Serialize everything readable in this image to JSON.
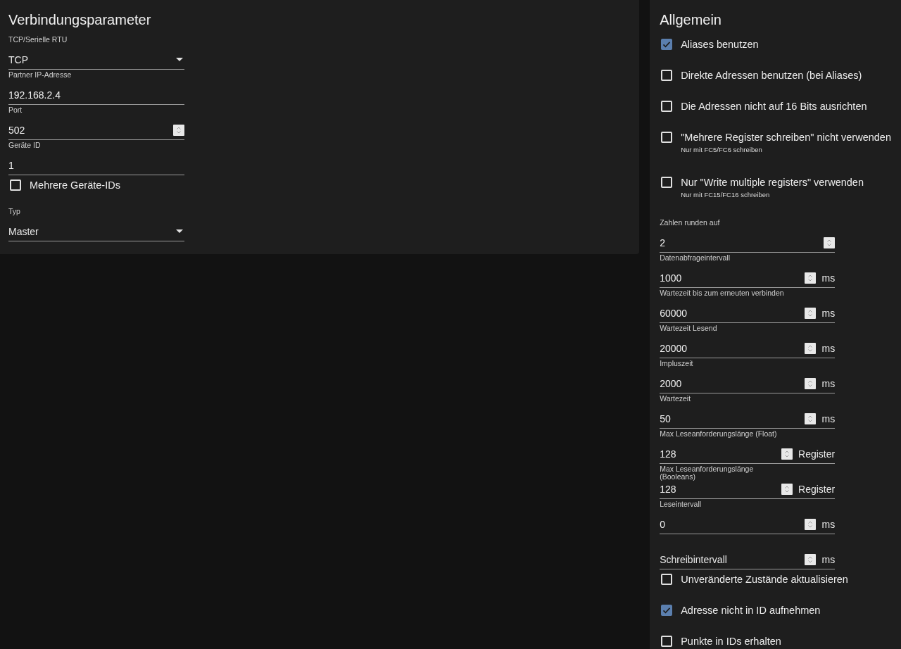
{
  "connection": {
    "title": "Verbindungsparameter",
    "fields": [
      {
        "kind": "select",
        "label": "TCP/Serielle RTU",
        "value": "TCP"
      },
      {
        "kind": "text",
        "label": "Partner IP-Adresse",
        "value": "192.168.2.4"
      },
      {
        "kind": "number",
        "label": "Port",
        "value": "502"
      },
      {
        "kind": "text",
        "label": "Geräte ID",
        "value": "1"
      },
      {
        "kind": "checkbox",
        "label": "Mehrere Geräte-IDs",
        "checked": false
      },
      {
        "kind": "select",
        "label": "Typ",
        "value": "Master"
      }
    ]
  },
  "general": {
    "title": "Allgemein",
    "items": [
      {
        "kind": "checkbox",
        "label": "Aliases benutzen",
        "checked": true
      },
      {
        "kind": "checkbox",
        "label": "Direkte Adressen benutzen (bei Aliases)",
        "checked": false
      },
      {
        "kind": "checkbox",
        "label": "Die Adressen nicht auf 16 Bits ausrichten",
        "checked": false
      },
      {
        "kind": "checkbox",
        "label": "\"Mehrere Register schreiben\" nicht verwenden",
        "hint": "Nur mit FC5/FC6 schreiben",
        "checked": false
      },
      {
        "kind": "checkbox",
        "label": "Nur \"Write multiple registers\" verwenden",
        "hint": "Nur mit FC15/FC16 schreiben",
        "checked": false
      },
      {
        "kind": "number",
        "label": "Zahlen runden auf",
        "value": "2"
      },
      {
        "kind": "number",
        "label": "Datenabfrageintervall",
        "value": "1000",
        "unit": "ms"
      },
      {
        "kind": "number",
        "label": "Wartezeit bis zum erneuten verbinden",
        "value": "60000",
        "unit": "ms"
      },
      {
        "kind": "number",
        "label": "Wartezeit Lesend",
        "value": "20000",
        "unit": "ms"
      },
      {
        "kind": "number",
        "label": "Impluszeit",
        "value": "2000",
        "unit": "ms"
      },
      {
        "kind": "number",
        "label": "Wartezeit",
        "value": "50",
        "unit": "ms"
      },
      {
        "kind": "number",
        "label": "Max Leseanforderungslänge (Float)",
        "value": "128",
        "unit": "Register"
      },
      {
        "kind": "number",
        "label": "Max Leseanforderungslänge (Booleans)",
        "value": "128",
        "unit": "Register"
      },
      {
        "kind": "number",
        "label": "Leseintervall",
        "value": "0",
        "unit": "ms"
      },
      {
        "kind": "number",
        "placeholder": "Schreibintervall",
        "unit": "ms"
      },
      {
        "kind": "checkbox",
        "label": "Unveränderte Zustände aktualisieren",
        "checked": false
      },
      {
        "kind": "checkbox",
        "label": "Adresse nicht in ID aufnehmen",
        "checked": true
      },
      {
        "kind": "checkbox",
        "label": "Punkte in IDs erhalten",
        "checked": false
      }
    ]
  }
}
